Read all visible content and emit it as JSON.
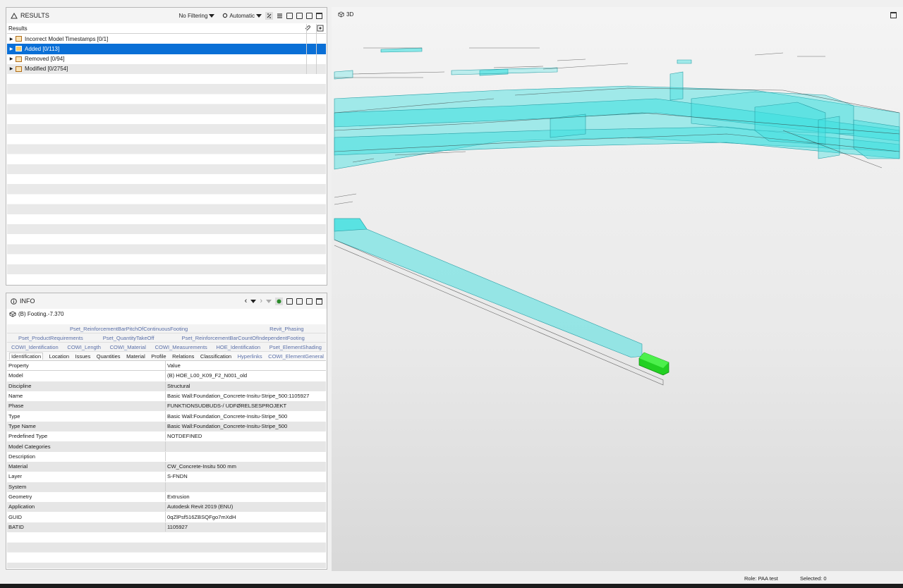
{
  "results": {
    "title": "RESULTS",
    "filter_label": "No Filtering",
    "mode_label": "Automatic",
    "column_header": "Results",
    "items": [
      {
        "label": "Incorrect Model Timestamps [0/1]"
      },
      {
        "label": "Added [0/113]"
      },
      {
        "label": "Removed [0/94]"
      },
      {
        "label": "Modified [0/2754]"
      }
    ]
  },
  "info": {
    "title": "INFO",
    "element_label": "(B) Footing.-7.370",
    "tab_rows": [
      [
        "Pset_ReinforcementBarPitchOfContinuousFooting",
        "Revit_Phasing"
      ],
      [
        "Pset_ProductRequirements",
        "Pset_QuantityTakeOff",
        "Pset_ReinforcementBarCountOfIndependentFooting"
      ],
      [
        "COWI_Identification",
        "COWI_Length",
        "COWI_Material",
        "COWI_Measurements",
        "HOE_Identification",
        "Pset_ElementShading"
      ],
      [
        "Identification",
        "Location",
        "Issues",
        "Quantities",
        "Material",
        "Profile",
        "Relations",
        "Classification",
        "Hyperlinks",
        "COWI_ElementGeneral"
      ]
    ],
    "table_headers": {
      "property": "Property",
      "value": "Value"
    },
    "properties": [
      {
        "p": "Model",
        "v": "(B) HOE_L00_K09_F2_N001_old"
      },
      {
        "p": "Discipline",
        "v": "Structural"
      },
      {
        "p": "Name",
        "v": "Basic Wall:Foundation_Concrete-Insitu-Stripe_500:1105927"
      },
      {
        "p": "Phase",
        "v": "FUNKTIONSUDBUDS-/ UDFØRELSESPROJEKT"
      },
      {
        "p": "Type",
        "v": "Basic Wall:Foundation_Concrete-Insitu-Stripe_500"
      },
      {
        "p": "Type Name",
        "v": "Basic Wall:Foundation_Concrete-Insitu-Stripe_500"
      },
      {
        "p": "Predefined Type",
        "v": "NOTDEFINED"
      },
      {
        "p": "Model Categories",
        "v": ""
      },
      {
        "p": "Description",
        "v": ""
      },
      {
        "p": "Material",
        "v": "CW_Concrete-Insitu 500 mm"
      },
      {
        "p": "Layer",
        "v": "S-FNDN"
      },
      {
        "p": "System",
        "v": ""
      },
      {
        "p": "Geometry",
        "v": "Extrusion"
      },
      {
        "p": "Application",
        "v": "Autodesk Revit 2019 (ENU)"
      },
      {
        "p": "GUID",
        "v": "0qZlPsf516ZBSQFgo7mXdH"
      },
      {
        "p": "BATID",
        "v": "1105927"
      }
    ]
  },
  "view3d": {
    "title": "3D"
  },
  "status": {
    "role": "Role: PAA test",
    "selected": "Selected: 0"
  },
  "colors": {
    "selection": "#0a6fd6",
    "model_cyan": "#3fe0e0",
    "highlight_green": "#22d022"
  }
}
